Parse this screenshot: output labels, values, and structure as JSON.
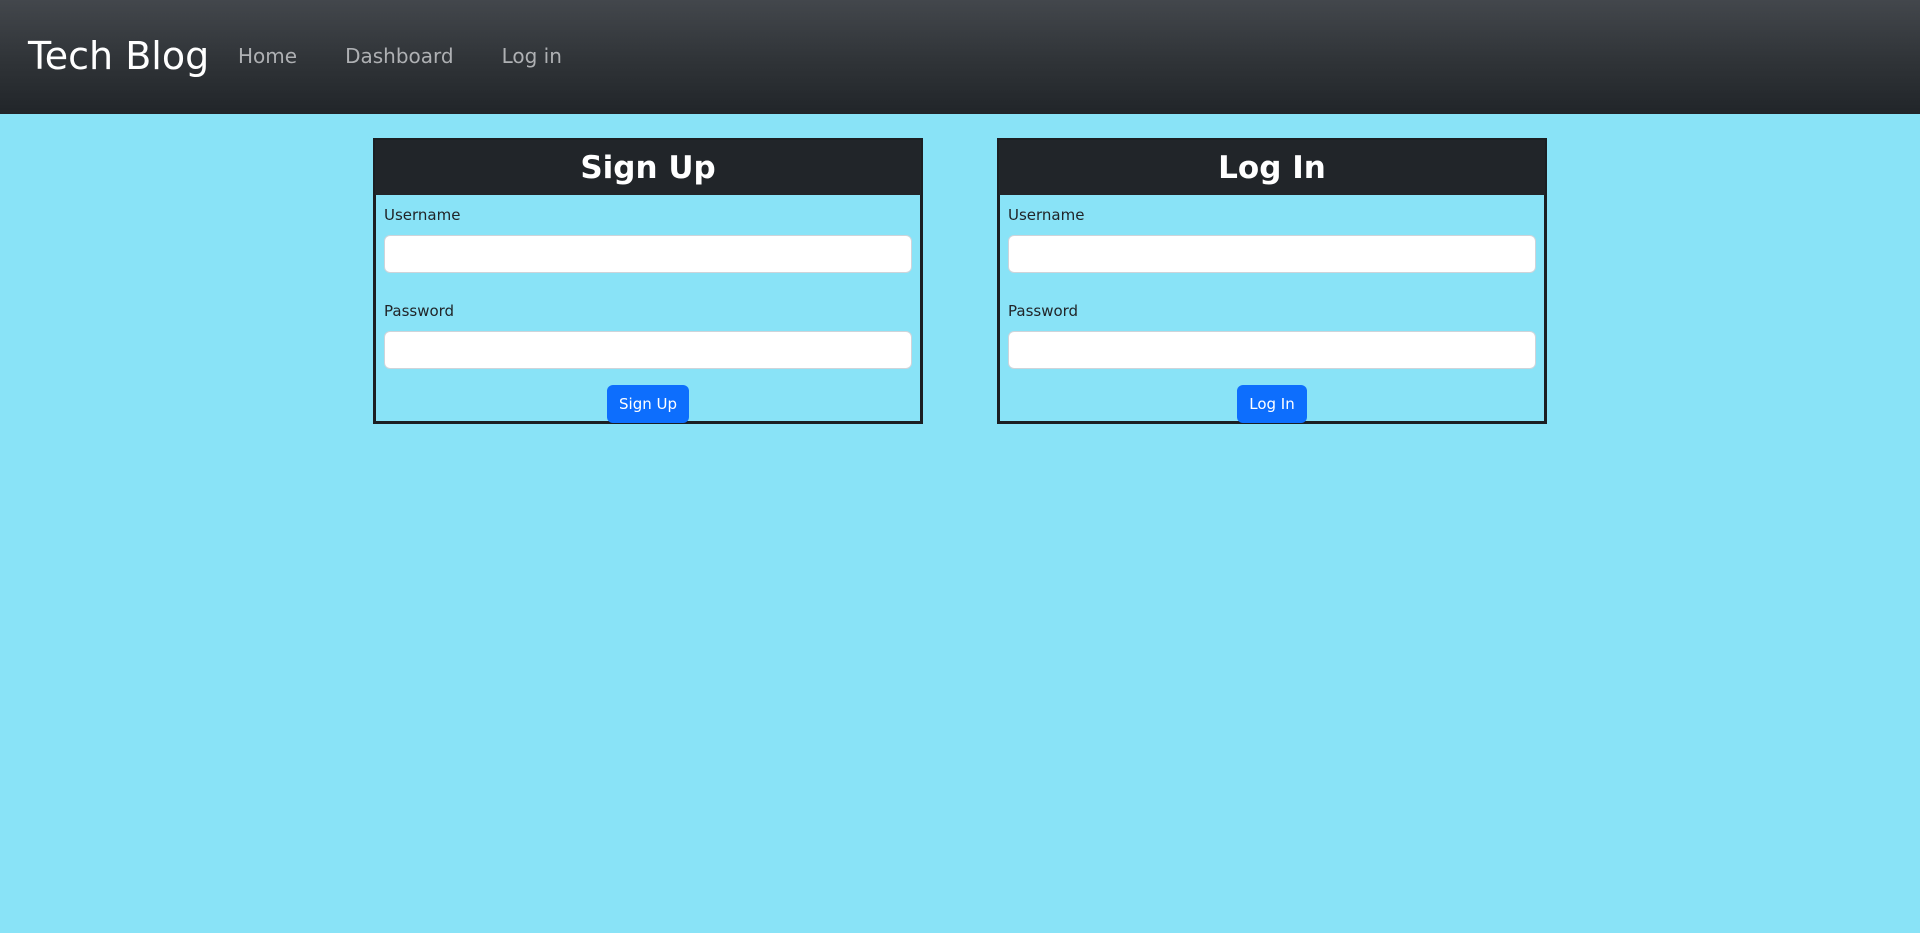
{
  "navbar": {
    "brand": "Tech Blog",
    "links": [
      {
        "label": "Home"
      },
      {
        "label": "Dashboard"
      },
      {
        "label": "Log in"
      }
    ]
  },
  "signup": {
    "title": "Sign Up",
    "username_label": "Username",
    "username_value": "",
    "password_label": "Password",
    "password_value": "",
    "button_label": "Sign Up"
  },
  "login": {
    "title": "Log In",
    "username_label": "Username",
    "username_value": "",
    "password_label": "Password",
    "password_value": "",
    "button_label": "Log In"
  },
  "colors": {
    "background": "#89e3f7",
    "navbar": "#212529",
    "card_header": "#212529",
    "primary_button": "#0d6efd"
  }
}
